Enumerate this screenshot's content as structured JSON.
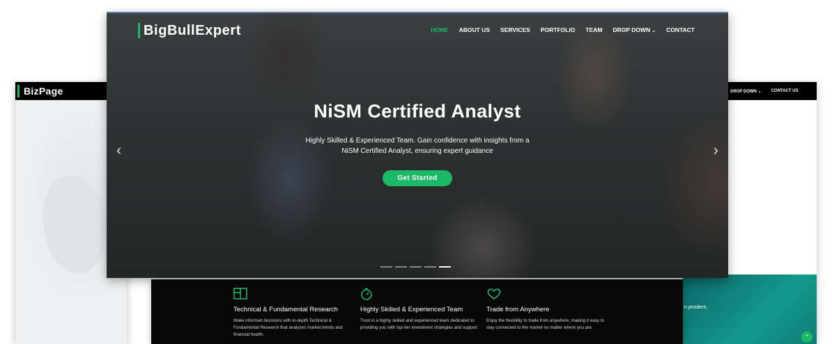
{
  "back_left": {
    "logo": "BizPage"
  },
  "back_right": {
    "nav": [
      "DROP DOWN ⌄",
      "CONTACT US"
    ],
    "partial_text": "n proident,"
  },
  "hero": {
    "logo": "BigBullExpert",
    "nav": [
      {
        "label": "HOME",
        "active": true
      },
      {
        "label": "ABOUT US"
      },
      {
        "label": "SERVICES"
      },
      {
        "label": "PORTFOLIO"
      },
      {
        "label": "TEAM"
      },
      {
        "label": "DROP DOWN"
      },
      {
        "label": "CONTACT"
      }
    ],
    "title": "NiSM Certified Analyst",
    "subtitle_line1": "Highly Skilled & Experienced Team. Gain confidence with insights from a",
    "subtitle_line2": "NiSM Certified Analyst, ensuring expert guidance",
    "cta": "Get Started",
    "carousel": {
      "slides": 5,
      "active_slide": 5
    }
  },
  "features": [
    {
      "icon": "folder-chart-icon",
      "title": "Technical & Fundamental Research",
      "text": "Make informed decisions with in-depth Technical & Fundamental Research that analyzes market trends and financial health."
    },
    {
      "icon": "stopwatch-icon",
      "title": "Highly Skilled & Experienced Team",
      "text": "Trust in a highly skilled and experienced team dedicated to providing you with top-tier investment strategies and support."
    },
    {
      "icon": "heart-icon",
      "title": "Trade from Anywhere",
      "text": "Enjoy the flexibility to trade from anywhere, making it easy to stay connected to the market no matter where you are."
    }
  ],
  "colors": {
    "accent": "#1bb866",
    "dark": "#070707"
  }
}
